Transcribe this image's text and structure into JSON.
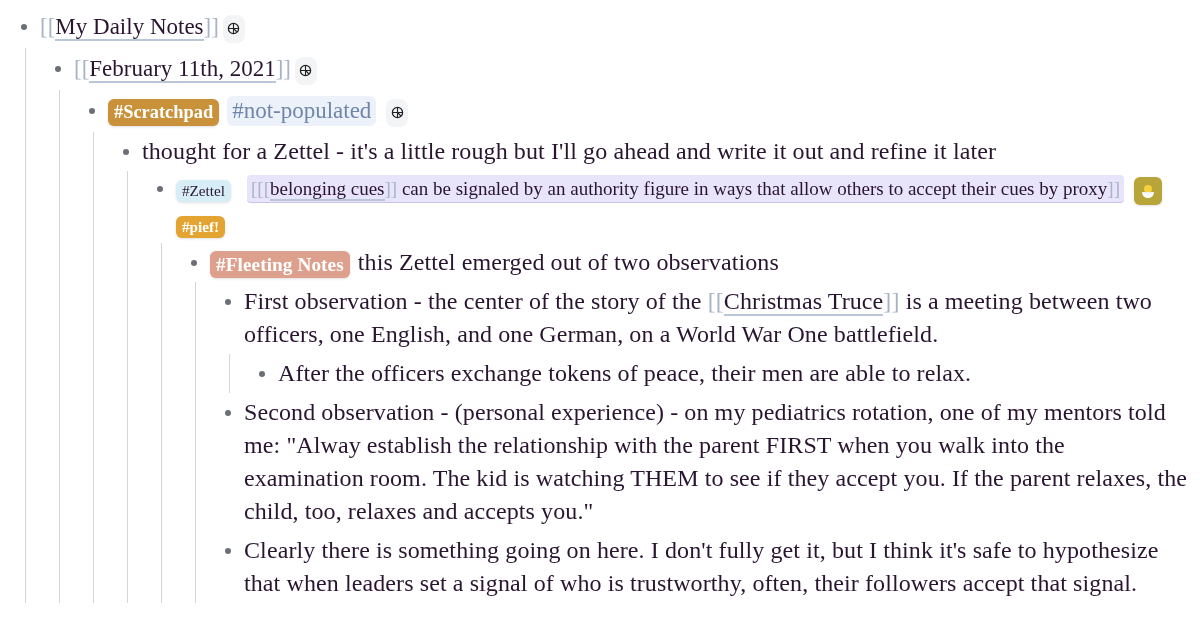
{
  "blocks": [
    {
      "segments": [
        {
          "kind": "bracket",
          "text": "[["
        },
        {
          "kind": "link",
          "text": "My Daily Notes"
        },
        {
          "kind": "bracket",
          "text": "]]"
        },
        {
          "kind": "icon_button"
        }
      ],
      "children": [
        {
          "segments": [
            {
              "kind": "bracket",
              "text": "[["
            },
            {
              "kind": "link",
              "text": "February 11th, 2021"
            },
            {
              "kind": "bracket",
              "text": "]]"
            },
            {
              "kind": "icon_button"
            }
          ],
          "children": [
            {
              "segments": [
                {
                  "kind": "tag",
                  "text": "#Scratchpad",
                  "color": "#c8913a"
                },
                {
                  "kind": "plain_tag",
                  "text": "#not-populated"
                },
                {
                  "kind": "icon_button"
                }
              ],
              "children": [
                {
                  "segments": [
                    {
                      "kind": "text",
                      "text": "thought for a Zettel - it's a little rough but I'll go ahead and write it out and refine it later"
                    }
                  ],
                  "children": [
                    {
                      "segments": [
                        {
                          "kind": "tag",
                          "text": "#Zettel",
                          "color": "#d8eef7"
                        },
                        {
                          "kind": "blockref",
                          "segments": [
                            {
                              "kind": "bracket",
                              "text": "[[["
                            },
                            {
                              "kind": "link",
                              "text": "belonging cues"
                            },
                            {
                              "kind": "bracket",
                              "text": "]]"
                            },
                            {
                              "kind": "text",
                              "text": " can be signaled by an authority figure in ways that allow others to accept their cues by proxy"
                            },
                            {
                              "kind": "bracket",
                              "text": "]]"
                            }
                          ]
                        },
                        {
                          "kind": "emoji_button",
                          "color": "#b7a53a"
                        },
                        {
                          "kind": "tag",
                          "text": "#pief!",
                          "color": "#e3a432"
                        }
                      ],
                      "children": [
                        {
                          "segments": [
                            {
                              "kind": "tag",
                              "text": "#Fleeting Notes",
                              "color": "#dca08c"
                            },
                            {
                              "kind": "text",
                              "text": "this Zettel emerged out of two observations"
                            }
                          ],
                          "children": [
                            {
                              "segments": [
                                {
                                  "kind": "text",
                                  "text": "First observation - the center of the story of the "
                                },
                                {
                                  "kind": "bracket",
                                  "text": "[["
                                },
                                {
                                  "kind": "link",
                                  "text": "Christmas Truce"
                                },
                                {
                                  "kind": "bracket",
                                  "text": "]]"
                                },
                                {
                                  "kind": "text",
                                  "text": " is a meeting between two officers, one English, and one German, on a World War One battlefield."
                                }
                              ],
                              "children": [
                                {
                                  "segments": [
                                    {
                                      "kind": "text",
                                      "text": "After the officers exchange tokens of peace, their men are able to relax."
                                    }
                                  ]
                                }
                              ]
                            },
                            {
                              "segments": [
                                {
                                  "kind": "text",
                                  "text": "Second observation - (personal experience) - on my pediatrics rotation, one of my mentors told me: \"Alway establish the relationship with the parent FIRST when you walk into the examination room. The kid is watching THEM to see if they accept you. If the parent relaxes, the child, too, relaxes and accepts you.\""
                                }
                              ]
                            },
                            {
                              "segments": [
                                {
                                  "kind": "text",
                                  "text": "Clearly there is something going on here. I don't fully get it, but I think it's safe to hypothesize that when leaders set a signal of who is trustworthy, often, their followers accept that signal."
                                }
                              ]
                            }
                          ]
                        }
                      ]
                    }
                  ]
                }
              ]
            }
          ]
        }
      ]
    }
  ]
}
